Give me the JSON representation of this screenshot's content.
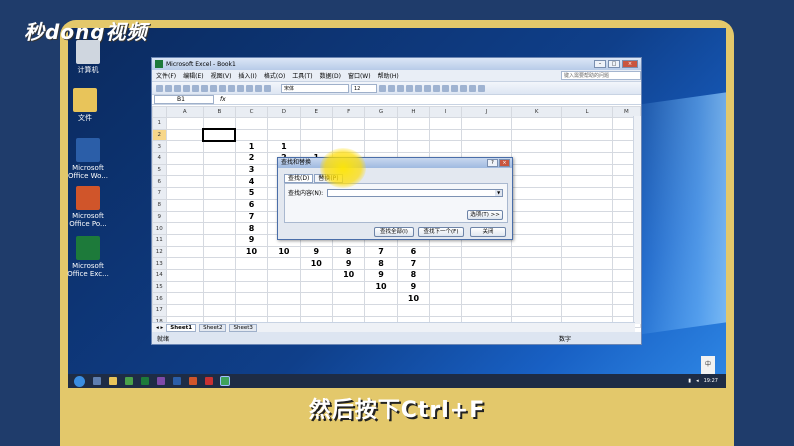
{
  "overlay_logo": "秒dong视频",
  "caption": "然后按下Ctrl+F",
  "desktop_icons": [
    {
      "label": "计算机",
      "color": "#cfd6df"
    },
    {
      "label": "文件",
      "color": "#e8c45a"
    },
    {
      "label": "Microsoft Office Wo...",
      "color": "#2b5ea8"
    },
    {
      "label": "Microsoft Office Po...",
      "color": "#d0552a"
    },
    {
      "label": "Microsoft Office Exc...",
      "color": "#1d7a3a"
    }
  ],
  "excel": {
    "title": "Microsoft Excel - Book1",
    "menu": [
      "文件(F)",
      "编辑(E)",
      "视图(V)",
      "插入(I)",
      "格式(O)",
      "工具(T)",
      "数据(D)",
      "窗口(W)",
      "帮助(H)"
    ],
    "help_placeholder": "键入需要帮助的问题",
    "font_name": "宋体",
    "font_size": "12",
    "name_box": "B1",
    "fx": "fx",
    "columns": [
      "A",
      "B",
      "C",
      "D",
      "E",
      "F",
      "G",
      "H",
      "I",
      "J",
      "K",
      "L",
      "M"
    ],
    "rows": [
      "1",
      "2",
      "3",
      "4",
      "5",
      "6",
      "7",
      "8",
      "9",
      "10",
      "11",
      "12",
      "13",
      "14",
      "15",
      "16",
      "17",
      "18"
    ],
    "cells": {
      "C": {
        "3": "1",
        "4": "2",
        "5": "3",
        "6": "4",
        "7": "5",
        "8": "6",
        "9": "7",
        "10": "8",
        "11": "9",
        "12": "10"
      },
      "D": {
        "3": "1",
        "4": "2",
        "12": "10"
      },
      "E": {
        "4": "1",
        "12": "9",
        "13": "10"
      },
      "F": {
        "12": "8",
        "13": "9",
        "14": "10"
      },
      "G": {
        "12": "7",
        "13": "8",
        "14": "9",
        "15": "10"
      },
      "H": {
        "12": "6",
        "13": "7",
        "14": "8",
        "15": "9",
        "16": "10"
      }
    },
    "sheets": [
      "Sheet1",
      "Sheet2",
      "Sheet3"
    ],
    "status_left": "就绪",
    "status_num": "数字"
  },
  "dialog": {
    "title": "查找和替换",
    "tab_find": "查找(D)",
    "tab_replace": "替换(P)",
    "find_label": "查找内容(N):",
    "find_value": "",
    "options": "选项(T) >>",
    "find_all": "查找全部(I)",
    "find_next": "查找下一个(F)",
    "close": "关闭"
  },
  "taskbar": {
    "time": "19:27",
    "lang": "中"
  }
}
